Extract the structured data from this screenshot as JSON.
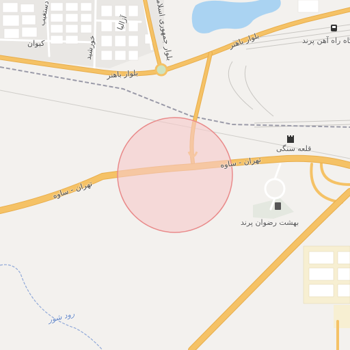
{
  "map": {
    "highlight_circle": {
      "fill": "#f7c9c9",
      "stroke": "#e98a8a"
    },
    "colors": {
      "land": "#f3f1ee",
      "urban": "#e9e7e4",
      "block": "#ffffff",
      "water": "#aad3f2",
      "major_road": "#f5c266",
      "major_road_casing": "#e8ad4a",
      "minor_road": "#ffffff",
      "railway": "#9a9aa8",
      "industrial": "#f7efd2",
      "river": "#8fa8d8"
    }
  },
  "labels": {
    "tehran_saveh_main": "تهران - ساوه",
    "tehran_saveh_left": "تهران - ساوه",
    "bahonar_top": "بلوار باهنر",
    "bahonar_left": "بلوار باهنر",
    "jomhouri": "بلوار جمهوری اسلامی",
    "kiyan": "کیوان",
    "khorshid": "خورشید",
    "arghavan": "آزالیا",
    "dastgheib": "دستغیب",
    "rah_ahan": "ایستگاه راه آهن پرند",
    "ghale_sangi": "قلعه سنگی",
    "behesht_rezvan": "بهشت رضوان پرند",
    "rud_shur": "رود شور"
  },
  "icons": {
    "train": "train-station-icon",
    "castle": "castle-icon",
    "cemetery": "cemetery-icon"
  }
}
